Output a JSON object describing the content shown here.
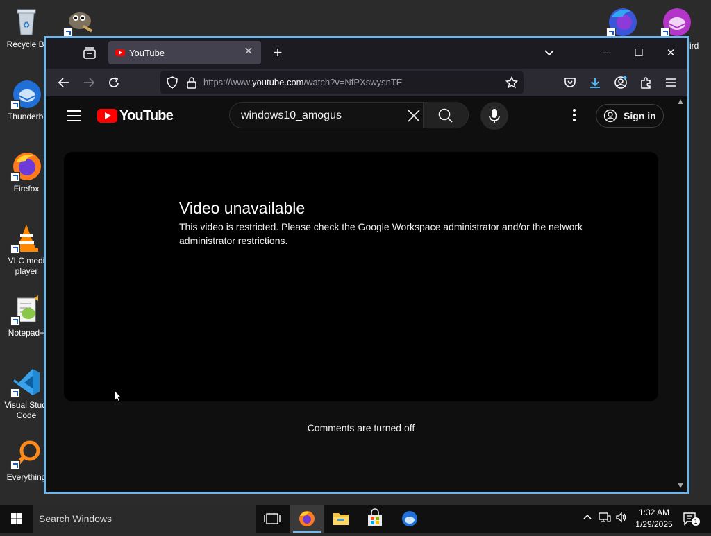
{
  "desktop": {
    "icons": [
      {
        "label": "Recycle Bi"
      },
      {
        "label": "Thunderbi"
      },
      {
        "label": "Firefox"
      },
      {
        "label": "VLC medi player"
      },
      {
        "label": "Notepad+"
      },
      {
        "label": "Visual Studi Code"
      },
      {
        "label": "Everything"
      },
      {
        "label": "ird"
      }
    ]
  },
  "browser": {
    "tab_title": "YouTube",
    "url_prefix": "https://www.",
    "url_domain": "youtube.com",
    "url_path": "/watch?v=NfPXswysnTE"
  },
  "youtube": {
    "logo_text": "YouTube",
    "search_value": "windows10_amogus",
    "signin_label": "Sign in",
    "error_title": "Video unavailable",
    "error_message": "This video is restricted. Please check the Google Workspace administrator and/or the network administrator restrictions.",
    "comments_text": "Comments are turned off"
  },
  "taskbar": {
    "search_placeholder": "Search Windows",
    "time": "1:32 AM",
    "date": "1/29/2025",
    "notification_count": "1"
  },
  "colors": {
    "window_border": "#6fb6e6",
    "youtube_red": "#ff0000",
    "download_blue": "#54c0ff"
  }
}
